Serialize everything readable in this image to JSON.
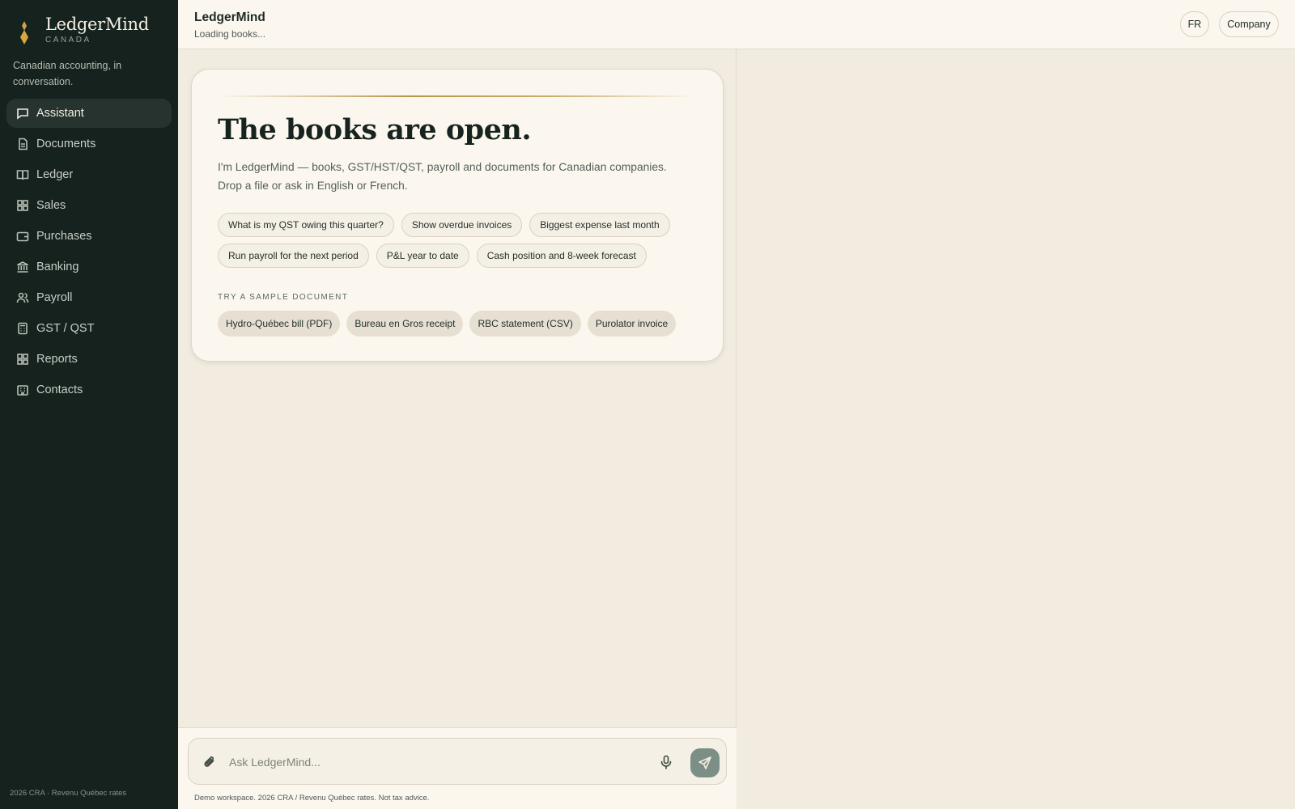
{
  "brand": {
    "name": "LedgerMind",
    "region": "CANADA",
    "tagline": "Canadian accounting, in conversation."
  },
  "nav": [
    {
      "label": "Assistant",
      "icon": "chat-bubble-icon",
      "active": true
    },
    {
      "label": "Documents",
      "icon": "document-icon"
    },
    {
      "label": "Ledger",
      "icon": "book-icon"
    },
    {
      "label": "Sales",
      "icon": "grid-icon"
    },
    {
      "label": "Purchases",
      "icon": "wallet-icon"
    },
    {
      "label": "Banking",
      "icon": "bank-icon"
    },
    {
      "label": "Payroll",
      "icon": "people-icon"
    },
    {
      "label": "GST / QST",
      "icon": "calculator-icon"
    },
    {
      "label": "Reports",
      "icon": "grid-icon"
    },
    {
      "label": "Contacts",
      "icon": "building-icon"
    }
  ],
  "sidebar_footer": "2026 CRA · Revenu Québec rates",
  "header": {
    "title": "LedgerMind",
    "subtitle": "Loading books...",
    "lang_button": "FR",
    "company_button": "Company"
  },
  "welcome": {
    "title": "The books are open.",
    "intro": "I'm LedgerMind — books, GST/HST/QST, payroll and documents for Canadian companies. Drop a file or ask in English or French.",
    "suggestions_row1": [
      "What is my QST owing this quarter?",
      "Show overdue invoices",
      "Biggest expense last month"
    ],
    "suggestions_row2": [
      "Run payroll for the next period",
      "P&L year to date",
      "Cash position and 8-week forecast"
    ],
    "sample_label": "TRY A SAMPLE DOCUMENT",
    "samples": [
      "Hydro-Québec bill (PDF)",
      "Bureau en Gros receipt",
      "RBC statement (CSV)",
      "Purolator invoice"
    ]
  },
  "composer": {
    "placeholder": "Ask LedgerMind...",
    "note": "Demo workspace. 2026 CRA / Revenu Québec rates. Not tax advice."
  },
  "colors": {
    "sidebar": "#15221d",
    "accent_gold": "#b8954a",
    "background": "#f1ebe0",
    "card": "#fbf7ef",
    "send": "#7c8f86"
  }
}
